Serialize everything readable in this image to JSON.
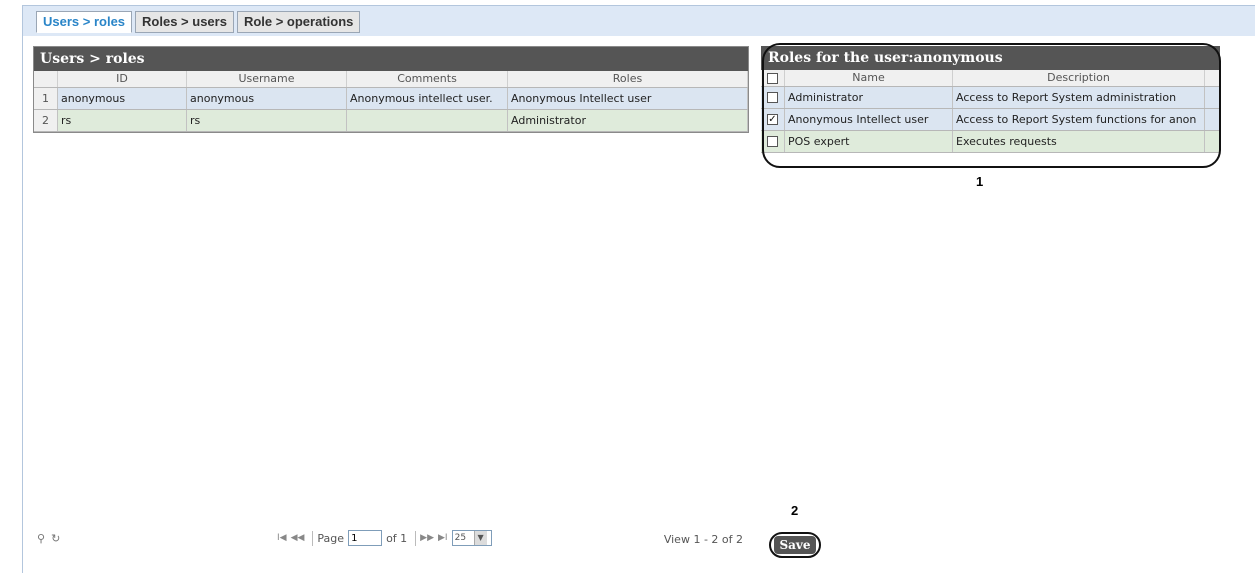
{
  "tabs": [
    {
      "label": "Users > roles",
      "active": true
    },
    {
      "label": "Roles > users",
      "active": false
    },
    {
      "label": "Role > operations",
      "active": false
    }
  ],
  "users_grid": {
    "title": "Users > roles",
    "columns": [
      "ID",
      "Username",
      "Comments",
      "Roles"
    ],
    "rows": [
      {
        "num": "1",
        "id": "anonymous",
        "username": "anonymous",
        "comments": "Anonymous intellect user.",
        "roles": "Anonymous Intellect user"
      },
      {
        "num": "2",
        "id": "rs",
        "username": "rs",
        "comments": "",
        "roles": "Administrator"
      }
    ]
  },
  "pager": {
    "page_label": "Page",
    "page_value": "1",
    "of_label": "of 1",
    "page_size": "25",
    "view_text": "View 1 - 2 of 2"
  },
  "roles_grid": {
    "title": "Roles for the user:anonymous",
    "columns": [
      "Name",
      "Description"
    ],
    "rows": [
      {
        "checked": false,
        "name": "Administrator",
        "description": "Access to Report System administration"
      },
      {
        "checked": true,
        "name": "Anonymous Intellect user",
        "description": "Access to Report System functions for anon"
      },
      {
        "checked": false,
        "name": "POS expert",
        "description": "Executes requests"
      }
    ]
  },
  "annotations": {
    "one": "1",
    "two": "2"
  },
  "save_label": "Save",
  "colors": {
    "accent": "#2a85c8",
    "header_bg": "#555555",
    "row_blue": "#dbe5f1",
    "row_green": "#dfebdb",
    "frame_bg": "#dde8f6"
  }
}
